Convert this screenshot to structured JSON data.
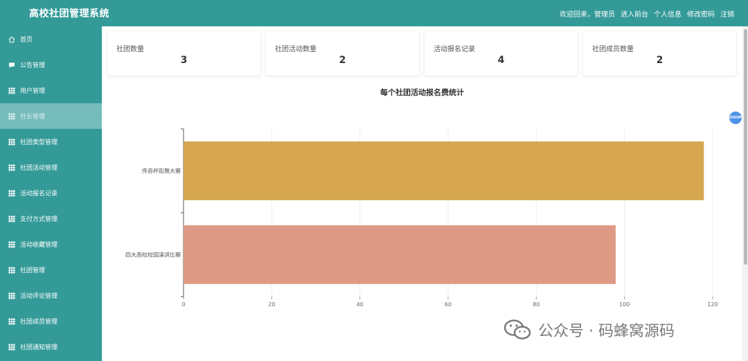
{
  "header": {
    "title": "高校社团管理系统",
    "welcome": "欢迎回来，管理员",
    "links": [
      "进入前台",
      "个人信息",
      "修改密码",
      "注销"
    ]
  },
  "sidebar": {
    "items": [
      {
        "label": "首页",
        "icon": "home-icon",
        "active": false
      },
      {
        "label": "公告管理",
        "icon": "comment-icon",
        "active": false
      },
      {
        "label": "用户管理",
        "icon": "grid-icon",
        "active": false
      },
      {
        "label": "社长管理",
        "icon": "grid-icon",
        "active": true
      },
      {
        "label": "社团类型管理",
        "icon": "grid-icon",
        "active": false
      },
      {
        "label": "社团活动管理",
        "icon": "grid-icon",
        "active": false
      },
      {
        "label": "活动报名记录",
        "icon": "grid-icon",
        "active": false
      },
      {
        "label": "支付方式管理",
        "icon": "grid-icon",
        "active": false
      },
      {
        "label": "活动收藏管理",
        "icon": "grid-icon",
        "active": false
      },
      {
        "label": "社团管理",
        "icon": "grid-icon",
        "active": false
      },
      {
        "label": "活动评论管理",
        "icon": "grid-icon",
        "active": false
      },
      {
        "label": "社团成员管理",
        "icon": "grid-icon",
        "active": false
      },
      {
        "label": "社团通知管理",
        "icon": "grid-icon",
        "active": false
      }
    ]
  },
  "stats": [
    {
      "label": "社团数量",
      "value": "3"
    },
    {
      "label": "社团活动数量",
      "value": "2"
    },
    {
      "label": "活动报名记录",
      "value": "4"
    },
    {
      "label": "社团成员数量",
      "value": "2"
    }
  ],
  "zoom_badge": "ZOOM",
  "watermark": {
    "text": "公众号 · 码蜂窝源码",
    "icon": "wechat-icon"
  },
  "colors": {
    "primary": "#339a98",
    "active": "#76bcbb",
    "bar1": "#d6a750",
    "bar2": "#df9a85"
  },
  "chart_data": {
    "type": "bar",
    "orientation": "horizontal",
    "title": "每个社团活动报名费统计",
    "categories": [
      "传奇杯街舞大赛",
      "四大高校校园演讲比赛"
    ],
    "values": [
      118,
      98
    ],
    "colors": [
      "#d6a750",
      "#df9a85"
    ],
    "xlim": [
      0,
      120
    ],
    "xticks": [
      0,
      20,
      40,
      60,
      80,
      100,
      120
    ],
    "grid": true
  }
}
